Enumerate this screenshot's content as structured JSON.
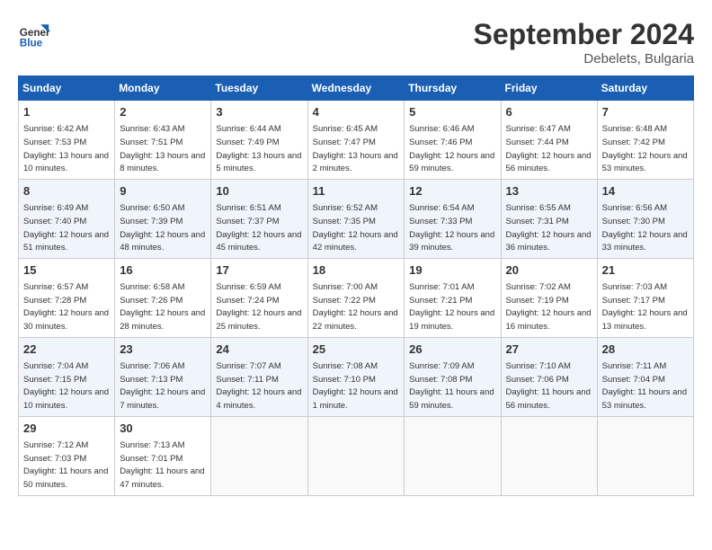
{
  "header": {
    "logo_line1": "General",
    "logo_line2": "Blue",
    "month_title": "September 2024",
    "location": "Debelets, Bulgaria"
  },
  "weekdays": [
    "Sunday",
    "Monday",
    "Tuesday",
    "Wednesday",
    "Thursday",
    "Friday",
    "Saturday"
  ],
  "weeks": [
    [
      {
        "day": "1",
        "sunrise": "6:42 AM",
        "sunset": "7:53 PM",
        "daylight": "13 hours and 10 minutes."
      },
      {
        "day": "2",
        "sunrise": "6:43 AM",
        "sunset": "7:51 PM",
        "daylight": "13 hours and 8 minutes."
      },
      {
        "day": "3",
        "sunrise": "6:44 AM",
        "sunset": "7:49 PM",
        "daylight": "13 hours and 5 minutes."
      },
      {
        "day": "4",
        "sunrise": "6:45 AM",
        "sunset": "7:47 PM",
        "daylight": "13 hours and 2 minutes."
      },
      {
        "day": "5",
        "sunrise": "6:46 AM",
        "sunset": "7:46 PM",
        "daylight": "12 hours and 59 minutes."
      },
      {
        "day": "6",
        "sunrise": "6:47 AM",
        "sunset": "7:44 PM",
        "daylight": "12 hours and 56 minutes."
      },
      {
        "day": "7",
        "sunrise": "6:48 AM",
        "sunset": "7:42 PM",
        "daylight": "12 hours and 53 minutes."
      }
    ],
    [
      {
        "day": "8",
        "sunrise": "6:49 AM",
        "sunset": "7:40 PM",
        "daylight": "12 hours and 51 minutes."
      },
      {
        "day": "9",
        "sunrise": "6:50 AM",
        "sunset": "7:39 PM",
        "daylight": "12 hours and 48 minutes."
      },
      {
        "day": "10",
        "sunrise": "6:51 AM",
        "sunset": "7:37 PM",
        "daylight": "12 hours and 45 minutes."
      },
      {
        "day": "11",
        "sunrise": "6:52 AM",
        "sunset": "7:35 PM",
        "daylight": "12 hours and 42 minutes."
      },
      {
        "day": "12",
        "sunrise": "6:54 AM",
        "sunset": "7:33 PM",
        "daylight": "12 hours and 39 minutes."
      },
      {
        "day": "13",
        "sunrise": "6:55 AM",
        "sunset": "7:31 PM",
        "daylight": "12 hours and 36 minutes."
      },
      {
        "day": "14",
        "sunrise": "6:56 AM",
        "sunset": "7:30 PM",
        "daylight": "12 hours and 33 minutes."
      }
    ],
    [
      {
        "day": "15",
        "sunrise": "6:57 AM",
        "sunset": "7:28 PM",
        "daylight": "12 hours and 30 minutes."
      },
      {
        "day": "16",
        "sunrise": "6:58 AM",
        "sunset": "7:26 PM",
        "daylight": "12 hours and 28 minutes."
      },
      {
        "day": "17",
        "sunrise": "6:59 AM",
        "sunset": "7:24 PM",
        "daylight": "12 hours and 25 minutes."
      },
      {
        "day": "18",
        "sunrise": "7:00 AM",
        "sunset": "7:22 PM",
        "daylight": "12 hours and 22 minutes."
      },
      {
        "day": "19",
        "sunrise": "7:01 AM",
        "sunset": "7:21 PM",
        "daylight": "12 hours and 19 minutes."
      },
      {
        "day": "20",
        "sunrise": "7:02 AM",
        "sunset": "7:19 PM",
        "daylight": "12 hours and 16 minutes."
      },
      {
        "day": "21",
        "sunrise": "7:03 AM",
        "sunset": "7:17 PM",
        "daylight": "12 hours and 13 minutes."
      }
    ],
    [
      {
        "day": "22",
        "sunrise": "7:04 AM",
        "sunset": "7:15 PM",
        "daylight": "12 hours and 10 minutes."
      },
      {
        "day": "23",
        "sunrise": "7:06 AM",
        "sunset": "7:13 PM",
        "daylight": "12 hours and 7 minutes."
      },
      {
        "day": "24",
        "sunrise": "7:07 AM",
        "sunset": "7:11 PM",
        "daylight": "12 hours and 4 minutes."
      },
      {
        "day": "25",
        "sunrise": "7:08 AM",
        "sunset": "7:10 PM",
        "daylight": "12 hours and 1 minute."
      },
      {
        "day": "26",
        "sunrise": "7:09 AM",
        "sunset": "7:08 PM",
        "daylight": "11 hours and 59 minutes."
      },
      {
        "day": "27",
        "sunrise": "7:10 AM",
        "sunset": "7:06 PM",
        "daylight": "11 hours and 56 minutes."
      },
      {
        "day": "28",
        "sunrise": "7:11 AM",
        "sunset": "7:04 PM",
        "daylight": "11 hours and 53 minutes."
      }
    ],
    [
      {
        "day": "29",
        "sunrise": "7:12 AM",
        "sunset": "7:03 PM",
        "daylight": "11 hours and 50 minutes."
      },
      {
        "day": "30",
        "sunrise": "7:13 AM",
        "sunset": "7:01 PM",
        "daylight": "11 hours and 47 minutes."
      },
      null,
      null,
      null,
      null,
      null
    ]
  ]
}
